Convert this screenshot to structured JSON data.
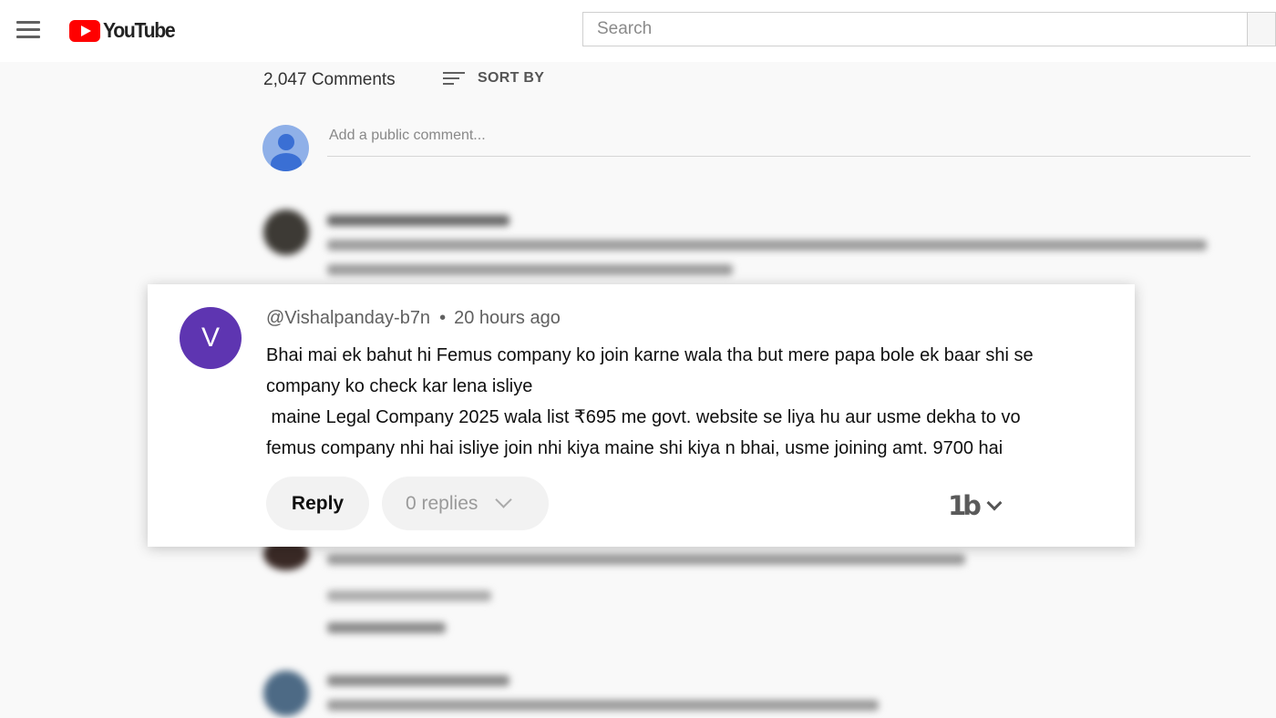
{
  "header": {
    "logo_text": "YouTube",
    "search_placeholder": "Search"
  },
  "comments": {
    "count": "2,047 Comments",
    "sort_label": "SORT BY",
    "add_placeholder": "Add a public comment..."
  },
  "highlighted_comment": {
    "avatar_letter": "V",
    "author": "@Vishalpanday-b7n",
    "separator": "•",
    "time": "20 hours ago",
    "lines": [
      "Bhai mai ek bahut hi Femus company ko join karne wala tha but mere papa bole ek baar shi se",
      "company ko check kar lena isliye",
      " maine Legal Company 2025 wala list ₹695 me govt. website se liya hu aur usme dekha to vo",
      "femus company nhi hai isliye join nhi kiya maine shi kiya n bhai, usme joining amt. 9700 hai"
    ],
    "reply_label": "Reply",
    "replies_label": "0 replies",
    "brand_mark": "1b"
  },
  "colors": {
    "brand_red": "#ff0000",
    "avatar_purple": "#5e35b1"
  }
}
